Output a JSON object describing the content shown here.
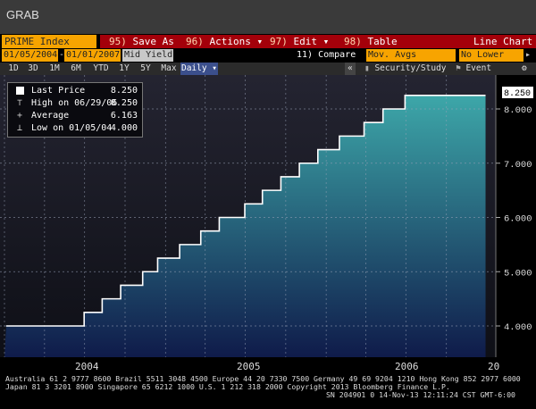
{
  "window": {
    "title": "GRAB"
  },
  "toolbar": {
    "security": "PRIME Index",
    "buttons": [
      {
        "num": "95)",
        "label": "Save As"
      },
      {
        "num": "96)",
        "label": "Actions ▾"
      },
      {
        "num": "97)",
        "label": "Edit ▾"
      },
      {
        "num": "98)",
        "label": "Table"
      }
    ],
    "chart_type": "Line Chart"
  },
  "range": {
    "start": "01/05/2004",
    "end": "01/01/2007",
    "mode": "Mid Yield ▾",
    "compare_label": "11) Compare",
    "compare_value": "Mov. Avgs",
    "lower_chart": "No Lower Char"
  },
  "periods": [
    "1D",
    "3D",
    "1M",
    "6M",
    "YTD",
    "1Y",
    "5Y",
    "Max"
  ],
  "period_selected": "Daily ▾",
  "right_buttons": {
    "collapse": "«",
    "security_study": "Security/Study",
    "event": "Event",
    "settings": "⚙"
  },
  "legend": {
    "last_price_label": "Last Price",
    "last_price_value": "8.250",
    "high_label": "High on 06/29/06",
    "high_value": "8.250",
    "average_label": "Average",
    "average_value": "6.163",
    "low_label": "Low on 01/05/04",
    "low_value": "4.000"
  },
  "price_tag": "8.250",
  "colors": {
    "orange": "#f7a400",
    "red": "#a4000a",
    "line": "#ffffff",
    "area_top": "#3da7a9",
    "area_bottom": "#0f1b4a"
  },
  "chart_data": {
    "type": "line",
    "series": [
      {
        "x": [
          "2004-01-05",
          "2004-06-30",
          "2004-08-10",
          "2004-09-21",
          "2004-11-10",
          "2004-12-14",
          "2005-02-02",
          "2005-03-22",
          "2005-05-03",
          "2005-06-30",
          "2005-08-09",
          "2005-09-20",
          "2005-11-01",
          "2005-12-13",
          "2006-01-31",
          "2006-03-28",
          "2006-05-10",
          "2006-06-29",
          "2006-12-29"
        ],
        "values": [
          4.0,
          4.25,
          4.5,
          4.75,
          5.0,
          5.25,
          5.5,
          5.75,
          6.0,
          6.25,
          6.5,
          6.75,
          7.0,
          7.25,
          7.5,
          7.75,
          8.0,
          8.25,
          8.25
        ]
      }
    ],
    "yticks": [
      "4.000",
      "5.000",
      "6.000",
      "7.000",
      "8.000"
    ],
    "xticks": [
      "2004",
      "2005",
      "2006",
      "20"
    ],
    "ylim": [
      3.6,
      8.5
    ],
    "xlim": [
      "2004-01-01",
      "2007-01-01"
    ],
    "grid": true
  },
  "footer": {
    "line1": "Australia 61 2 9777 8600 Brazil 5511 3048 4500 Europe 44 20 7330 7500 Germany 49 69 9204 1210 Hong Kong 852 2977 6000",
    "line2": "Japan 81 3 3201 8900        Singapore 65 6212 1000        U.S. 1 212 318 2000         Copyright 2013 Bloomberg Finance L.P.",
    "line3": "SN 204901 0 14-Nov-13 12:11:24 CST  GMT-6:00"
  }
}
